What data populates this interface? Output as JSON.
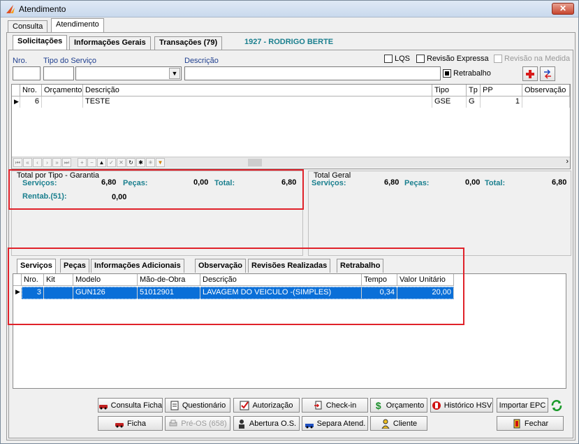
{
  "window": {
    "title": "Atendimento"
  },
  "top_tabs": [
    "Consulta",
    "Atendimento"
  ],
  "inner_tabs": [
    "Solicitações",
    "Informações Gerais",
    "Transações (79)"
  ],
  "customer": "1927 - RODRIGO BERTE",
  "form": {
    "nro_label": "Nro.",
    "tipo_servico_label": "Tipo do Serviço",
    "descricao_label": "Descrição",
    "lqs_label": "LQS",
    "revisao_expressa_label": "Revisão Expressa",
    "revisao_medida_label": "Revisão na Medida",
    "retrabalho_label": "Retrabalho"
  },
  "requests_table": {
    "headers": [
      "Nro.",
      "Orçamento",
      "Descrição",
      "Tipo",
      "Tp",
      "PP",
      "Observação"
    ],
    "rows": [
      {
        "nro": "6",
        "orcamento": "",
        "descricao": "TESTE",
        "tipo": "GSE",
        "tp": "G",
        "pp": "1",
        "observacao": ""
      }
    ]
  },
  "totals_tipo": {
    "title": "Total por Tipo - Garantia",
    "servicos_label": "Serviços:",
    "servicos_value": "6,80",
    "pecas_label": "Peças:",
    "pecas_value": "0,00",
    "total_label": "Total:",
    "total_value": "6,80",
    "rentab_label": "Rentab.(51):",
    "rentab_value": "0,00"
  },
  "totals_geral": {
    "title": "Total Geral",
    "servicos_label": "Serviços:",
    "servicos_value": "6,80",
    "pecas_label": "Peças:",
    "pecas_value": "0,00",
    "total_label": "Total:",
    "total_value": "6,80"
  },
  "sub_tabs": [
    "Serviços",
    "Peças",
    "Informações Adicionais",
    "Observação",
    "Revisões Realizadas",
    "Retrabalho"
  ],
  "services_table": {
    "headers": [
      "Nro.",
      "Kit",
      "Modelo",
      "Mão-de-Obra",
      "Descrição",
      "Tempo",
      "Valor Unitário"
    ],
    "rows": [
      {
        "nro": "3",
        "kit": "",
        "modelo": "GUN126",
        "mao_obra": "51012901",
        "descricao": "LAVAGEM DO VEICULO  -(SIMPLES)",
        "tempo": "0,34",
        "valor": "20,00"
      }
    ]
  },
  "buttons": {
    "consulta_ficha": "Consulta Ficha",
    "questionario": "Questionário",
    "autorizacao": "Autorização",
    "check_in": "Check-in",
    "orcamento": "Orçamento",
    "historico_hsv": "Histórico HSV",
    "importar_epc": "Importar EPC",
    "ficha": "Ficha",
    "pre_os": "Pré-OS (658)",
    "abertura_os": "Abertura O.S.",
    "separa_atend": "Separa Atend.",
    "cliente": "Cliente",
    "fechar": "Fechar"
  },
  "colors": {
    "highlight": "#0a6fd8",
    "frame_red": "#e0222a",
    "teal": "#1a7f8e"
  }
}
